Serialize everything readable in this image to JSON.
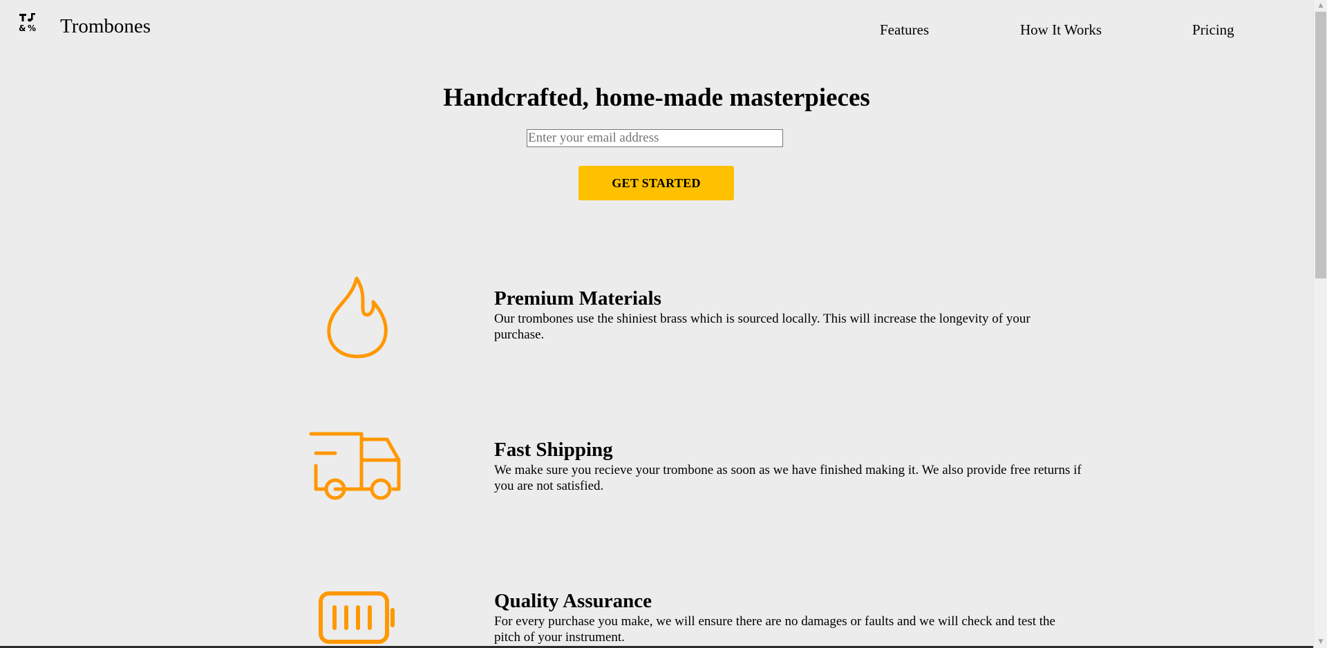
{
  "header": {
    "logo_icon": "music-notes-icon",
    "brand": "Trombones",
    "nav": [
      {
        "label": "Features"
      },
      {
        "label": "How It Works"
      },
      {
        "label": "Pricing"
      }
    ]
  },
  "hero": {
    "title": "Handcrafted, home-made masterpieces",
    "email_placeholder": "Enter your email address",
    "cta_label": "GET STARTED"
  },
  "features": [
    {
      "icon": "flame-icon",
      "title": "Premium Materials",
      "text": "Our trombones use the shiniest brass which is sourced locally. This will increase the longevity of your purchase."
    },
    {
      "icon": "delivery-truck-icon",
      "title": "Fast Shipping",
      "text": "We make sure you recieve your trombone as soon as we have finished making it. We also provide free returns if you are not satisfied."
    },
    {
      "icon": "battery-full-icon",
      "title": "Quality Assurance",
      "text": "For every purchase you make, we will ensure there are no damages or faults and we will check and test the pitch of your instrument."
    }
  ],
  "colors": {
    "background": "#ececec",
    "accent_button": "#ffc000",
    "icon_orange": "#ff9800"
  }
}
